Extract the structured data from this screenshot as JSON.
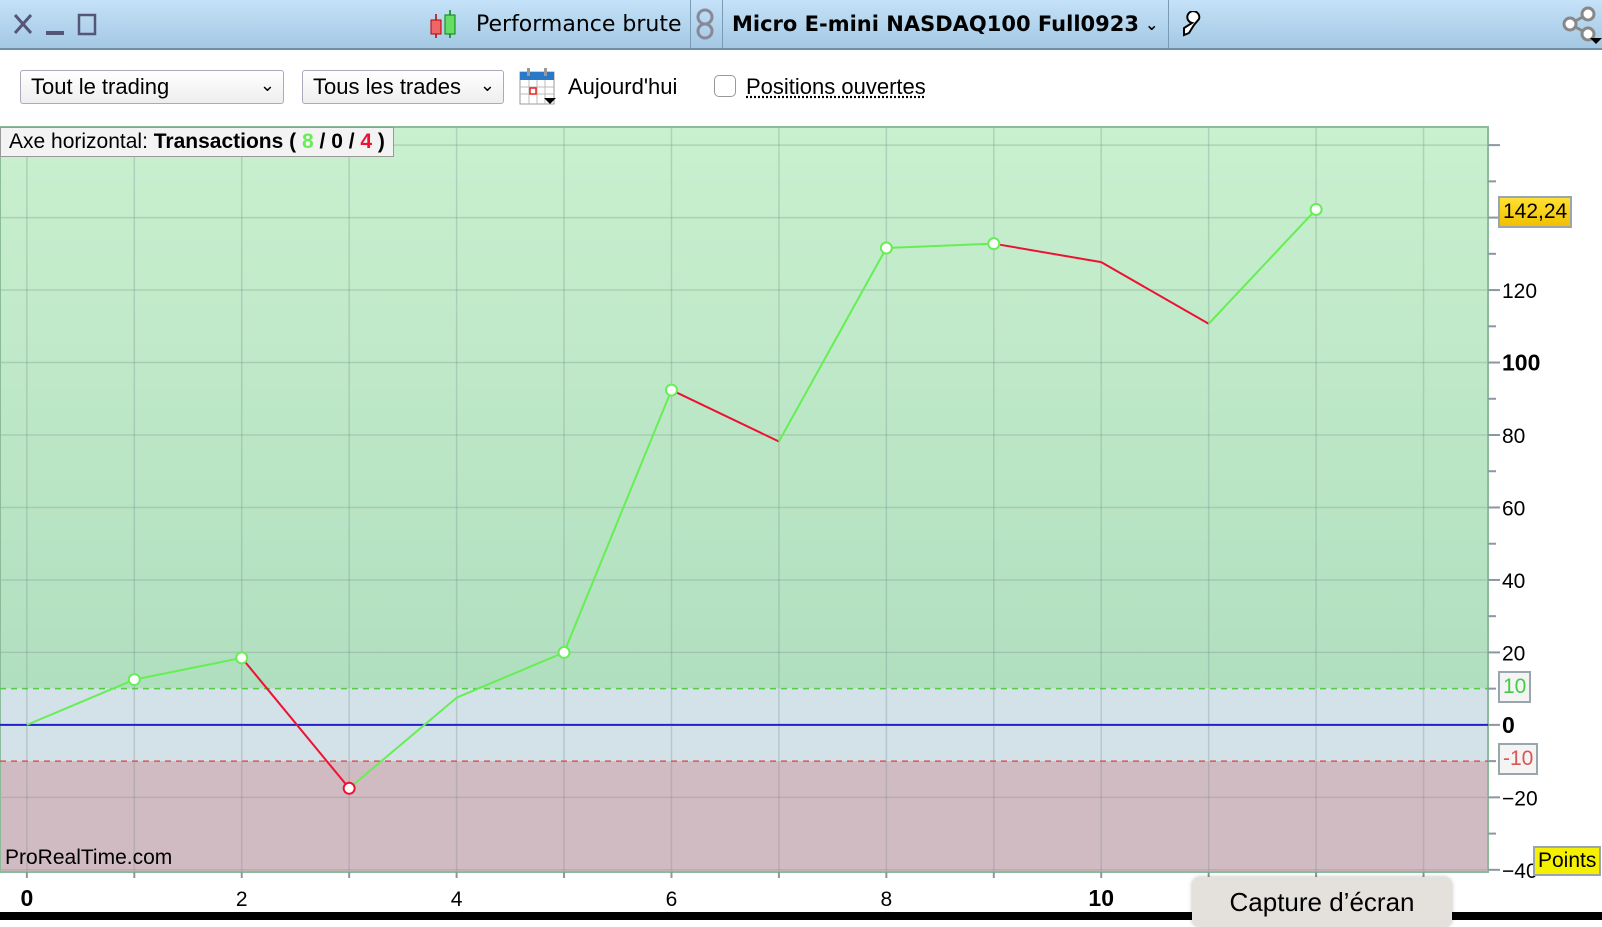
{
  "titlebar": {
    "title": "Performance brute",
    "instrument": "Micro E-mini NASDAQ100 Full0923"
  },
  "toolbar": {
    "period_select": "Tout le trading",
    "trades_select": "Tous les trades",
    "today_label": "Aujourd'hui",
    "open_positions_label": "Positions ouvertes",
    "open_positions_checked": false
  },
  "chart_header": {
    "prefix": "Axe horizontal: ",
    "axis_name": "Transactions",
    "open_paren": " ( ",
    "wins": "8",
    "slash1": " / ",
    "neutral": "0",
    "slash2": " / ",
    "losses": "4",
    "close_paren": " )"
  },
  "watermark": "ProRealTime.com",
  "last_value_label": "142,24",
  "upper_band_label": "10",
  "lower_band_label": "-10",
  "units_label": "Points",
  "capture_tooltip": "Capture d’écran",
  "colors": {
    "up": "#66ee55",
    "down": "#ee1133",
    "zero": "#2222cc"
  },
  "chart_data": {
    "type": "line",
    "xlabel": "Transactions",
    "ylabel": "Points",
    "x": [
      0,
      1,
      2,
      3,
      4,
      5,
      6,
      7,
      8,
      9,
      10,
      11,
      12
    ],
    "values": [
      0,
      12.5,
      18.5,
      -17.5,
      7.5,
      20,
      92.4,
      78.2,
      131.6,
      132.8,
      127.7,
      110.7,
      142.24
    ],
    "markers": [
      1,
      2,
      3,
      5,
      6,
      8,
      9,
      12
    ],
    "xlim": [
      -0.25,
      13.6
    ],
    "ylim": [
      -40.6,
      165
    ],
    "x_ticks": [
      0,
      2,
      4,
      6,
      8,
      10
    ],
    "x_tick_labels": [
      "0",
      "2",
      "4",
      "6",
      "8",
      "10"
    ],
    "y_ticks": [
      120,
      100,
      80,
      60,
      40,
      20,
      0,
      -20,
      -40
    ],
    "y_tick_labels": [
      "120",
      "100",
      "80",
      "60",
      "40",
      "20",
      "0",
      "−20",
      "−40"
    ],
    "bands": {
      "upper": 10,
      "lower": -10
    },
    "grid": true
  }
}
